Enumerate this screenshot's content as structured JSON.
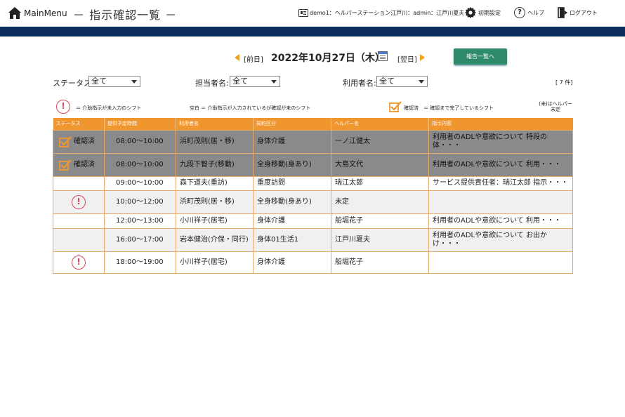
{
  "header": {
    "mainmenu": "MainMenu",
    "title": "－ 指示確認一覧 －",
    "user_info": "demo1：ヘルパーステーション江戸川：admin：江戸川夏夫",
    "settings": "初期設定",
    "help": "ヘルプ",
    "logout": "ログアウト"
  },
  "date_nav": {
    "prev": "[前日]",
    "date": "2022年10月27日（木）",
    "next": "[翌日]"
  },
  "report_button": "報告一覧へ",
  "filters": {
    "status_label": "ステータス:",
    "status_value": "全て",
    "staff_label": "担当者名:",
    "staff_value": "全て",
    "user_label": "利用者名:",
    "user_value": "全て",
    "count": "[ 7 件]"
  },
  "legend": {
    "warn_text": "＝ 介助指示が未入力のシフト",
    "blank_text": "空白 ＝ 介助指示が入力されているが確認が未のシフト",
    "confirmed_label": "確認済",
    "confirmed_text": "＝ 確認まで完了しているシフト",
    "note": "(未)はヘルパー未定"
  },
  "columns": [
    "ステータス",
    "提供予定時間",
    "利用者名",
    "契約区分",
    "ヘルパー名",
    "指示内容"
  ],
  "rows": [
    {
      "style": "confirmed",
      "status": "確認済",
      "time": "08:00～10:00",
      "user": "浜町茂則(居・移)",
      "contract": "身体介護",
      "helper": "一ノ江健太",
      "content": "利用者のADLや意欲について 特段の体・・・"
    },
    {
      "style": "confirmed",
      "status": "確認済",
      "time": "08:00～10:00",
      "user": "九段下智子(移動)",
      "contract": "全身移動(身あり)",
      "helper": "大島文代",
      "content": "利用者のADLや意欲について 利用・・・"
    },
    {
      "style": "white",
      "status": "",
      "time": "09:00～10:00",
      "user": "森下道夫(重訪)",
      "contract": "重度訪問",
      "helper": "瑞江太郎",
      "content": "サービス提供責任者：瑞江太郎 指示・・・"
    },
    {
      "style": "grey",
      "status": "warn",
      "time": "10:00～12:00",
      "user": "浜町茂則(居・移)",
      "contract": "全身移動(身あり)",
      "helper": "未定",
      "content": ""
    },
    {
      "style": "white",
      "status": "",
      "time": "12:00～13:00",
      "user": "小川祥子(居宅)",
      "contract": "身体介護",
      "helper": "船堀花子",
      "content": "利用者のADLや意欲について 利用・・・"
    },
    {
      "style": "grey",
      "status": "",
      "time": "16:00～17:00",
      "user": "岩本健治(介保・同行)",
      "contract": "身体01生活1",
      "helper": "江戸川夏夫",
      "content": "利用者のADLや意欲について お出かけ・・・"
    },
    {
      "style": "white",
      "status": "warn",
      "time": "18:00～19:00",
      "user": "小川祥子(居宅)",
      "contract": "身体介護",
      "helper": "船堀花子",
      "content": ""
    }
  ],
  "colors": {
    "navy": "#0b2d5c",
    "orange": "#f0962e",
    "green_button": "#2f8a6a",
    "warn_red": "#d84a5a",
    "confirmed_row": "#8a8a8a"
  }
}
